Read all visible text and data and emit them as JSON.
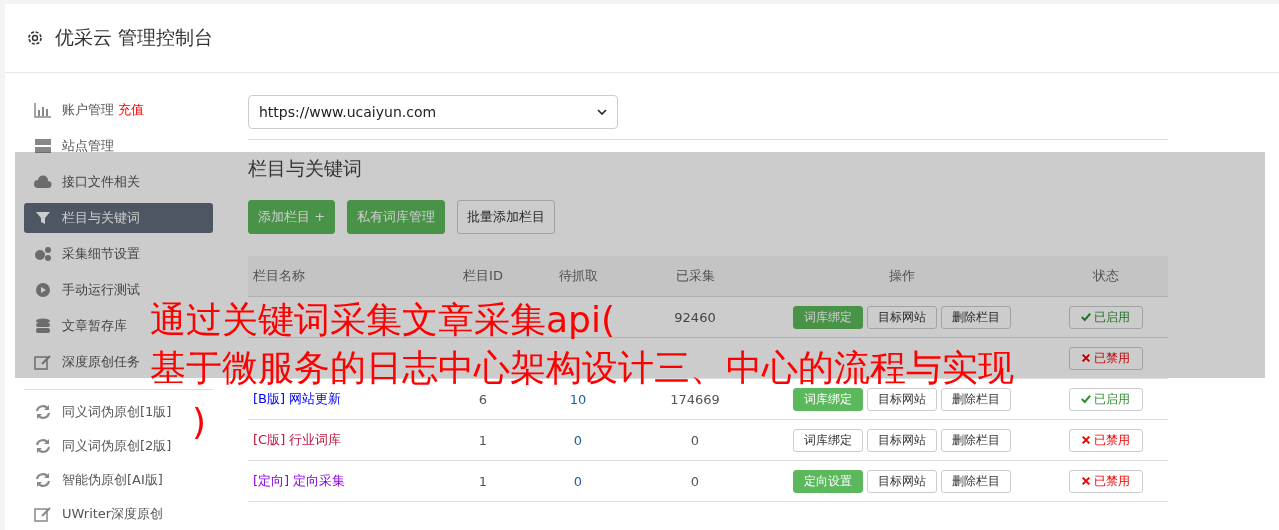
{
  "header": {
    "title": "优采云 管理控制台"
  },
  "sidebar": {
    "items": [
      {
        "label": "账户管理",
        "badge": "充值",
        "selected": false
      },
      {
        "label": "站点管理",
        "selected": false
      },
      {
        "label": "接口文件相关",
        "selected": false
      },
      {
        "label": "栏目与关键词",
        "selected": true
      },
      {
        "label": "采集细节设置",
        "selected": false
      },
      {
        "label": "手动运行测试",
        "selected": false
      },
      {
        "label": "文章暂存库",
        "selected": false
      },
      {
        "label": "深度原创任务",
        "selected": false
      }
    ],
    "tools": [
      {
        "label": "同义词伪原创[1版]"
      },
      {
        "label": "同义词伪原创[2版]"
      },
      {
        "label": "智能伪原创[AI版]"
      },
      {
        "label": "UWriter深度原创"
      }
    ]
  },
  "site_select": {
    "value": "https://www.ucaiyun.com"
  },
  "section": {
    "title": "栏目与关键词"
  },
  "actions": [
    {
      "label": "添加栏目 +",
      "primary": true
    },
    {
      "label": "私有词库管理",
      "primary": true
    },
    {
      "label": "批量添加栏目",
      "primary": false
    }
  ],
  "table": {
    "columns": [
      "栏目名称",
      "栏目ID",
      "待抓取",
      "已采集",
      "操作",
      "状态"
    ],
    "rows": [
      {
        "collected": "92460",
        "buttons": [
          {
            "label": "词库绑定",
            "primary": true
          },
          {
            "label": "目标网站",
            "primary": false
          },
          {
            "label": "删除栏目",
            "primary": false
          }
        ],
        "enabled": true,
        "status": "已启用"
      },
      {
        "buttons": [],
        "enabled": false,
        "status": "已禁用"
      },
      {
        "name": "[B版] 网站更新",
        "color": "#0000ff",
        "id": "6",
        "pending": "10",
        "collected": "174669",
        "buttons": [
          {
            "label": "词库绑定",
            "primary": true
          },
          {
            "label": "目标网站",
            "primary": false
          },
          {
            "label": "删除栏目",
            "primary": false
          }
        ],
        "enabled": true,
        "status": "已启用"
      },
      {
        "name": "[C版] 行业词库",
        "color": "#c0143c",
        "id": "1",
        "pending": "0",
        "collected": "0",
        "buttons": [
          {
            "label": "词库绑定",
            "primary": false
          },
          {
            "label": "目标网站",
            "primary": false
          },
          {
            "label": "删除栏目",
            "primary": false
          }
        ],
        "enabled": false,
        "status": "已禁用"
      },
      {
        "name": "[定向] 定向采集",
        "color": "#8a00e6",
        "id": "1",
        "pending": "0",
        "collected": "0",
        "buttons": [
          {
            "label": "定向设置",
            "primary": true
          },
          {
            "label": "目标网站",
            "primary": false
          },
          {
            "label": "删除栏目",
            "primary": false
          }
        ],
        "enabled": false,
        "status": "已禁用"
      }
    ]
  },
  "overlay": {
    "lines": [
      "通过关键词采集文章采集api(",
      "基于微服务的日志中心架构设计三、中心的流程与实现",
      ")"
    ]
  }
}
